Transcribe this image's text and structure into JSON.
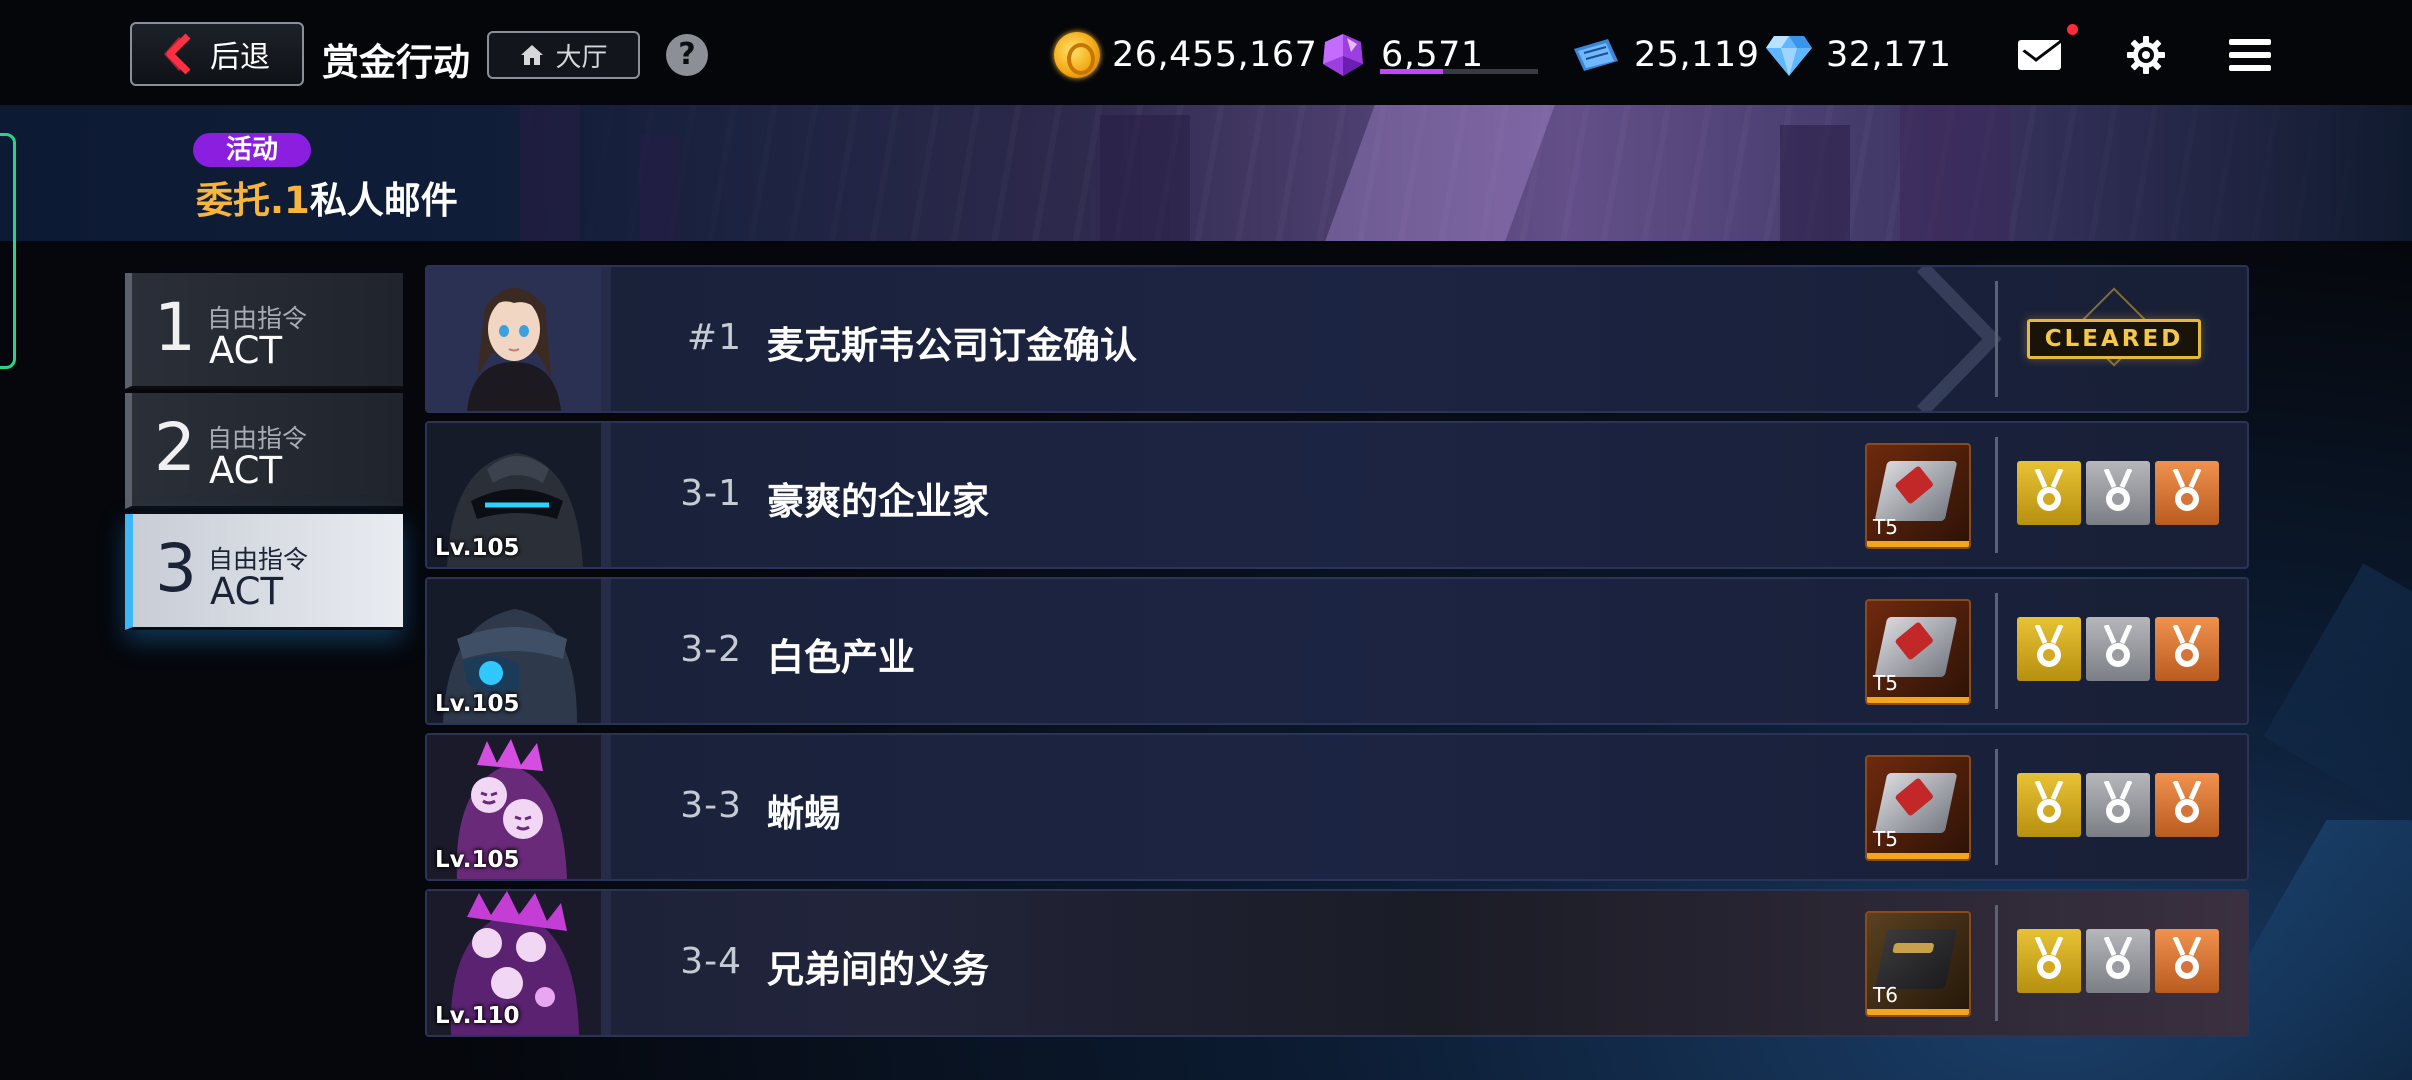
{
  "topbar": {
    "back_label": "后退",
    "title": "赏金行动",
    "lobby_label": "大厅",
    "help_label": "?"
  },
  "resources": {
    "gold": "26,455,167",
    "energy": "6,571",
    "energy_fill_percent": 40,
    "tickets": "25,119",
    "gems": "32,171"
  },
  "banner": {
    "tag": "活动",
    "title_highlight": "委托.1",
    "title_rest": "私人邮件"
  },
  "acts": [
    {
      "num": "1",
      "sub": "自由指令",
      "label": "ACT",
      "active": false
    },
    {
      "num": "2",
      "sub": "自由指令",
      "label": "ACT",
      "active": false
    },
    {
      "num": "3",
      "sub": "自由指令",
      "label": "ACT",
      "active": true
    }
  ],
  "missions": [
    {
      "code": "#1",
      "name": "麦克斯韦公司订金确认",
      "level": "",
      "status": "CLEARED"
    },
    {
      "code": "3-1",
      "name": "豪爽的企业家",
      "level": "Lv.105",
      "reward_tier": "T5"
    },
    {
      "code": "3-2",
      "name": "白色产业",
      "level": "Lv.105",
      "reward_tier": "T5"
    },
    {
      "code": "3-3",
      "name": "蜥蜴",
      "level": "Lv.105",
      "reward_tier": "T5"
    },
    {
      "code": "3-4",
      "name": "兄弟间的义务",
      "level": "Lv.110",
      "reward_tier": "T6"
    }
  ],
  "colors": {
    "accent_blue": "#3fb6f5",
    "event_purple": "#8a1fe0",
    "highlight_orange": "#f7b53e",
    "cleared_gold": "#e4b83a"
  },
  "icons": {
    "back": "chevron-left-icon",
    "lobby": "home-icon",
    "gold": "gold-coin-icon",
    "energy": "purple-crystal-icon",
    "tickets": "blue-ticket-icon",
    "gems": "diamond-icon",
    "mail": "mail-icon",
    "settings": "gear-icon",
    "menu": "hamburger-menu-icon"
  }
}
